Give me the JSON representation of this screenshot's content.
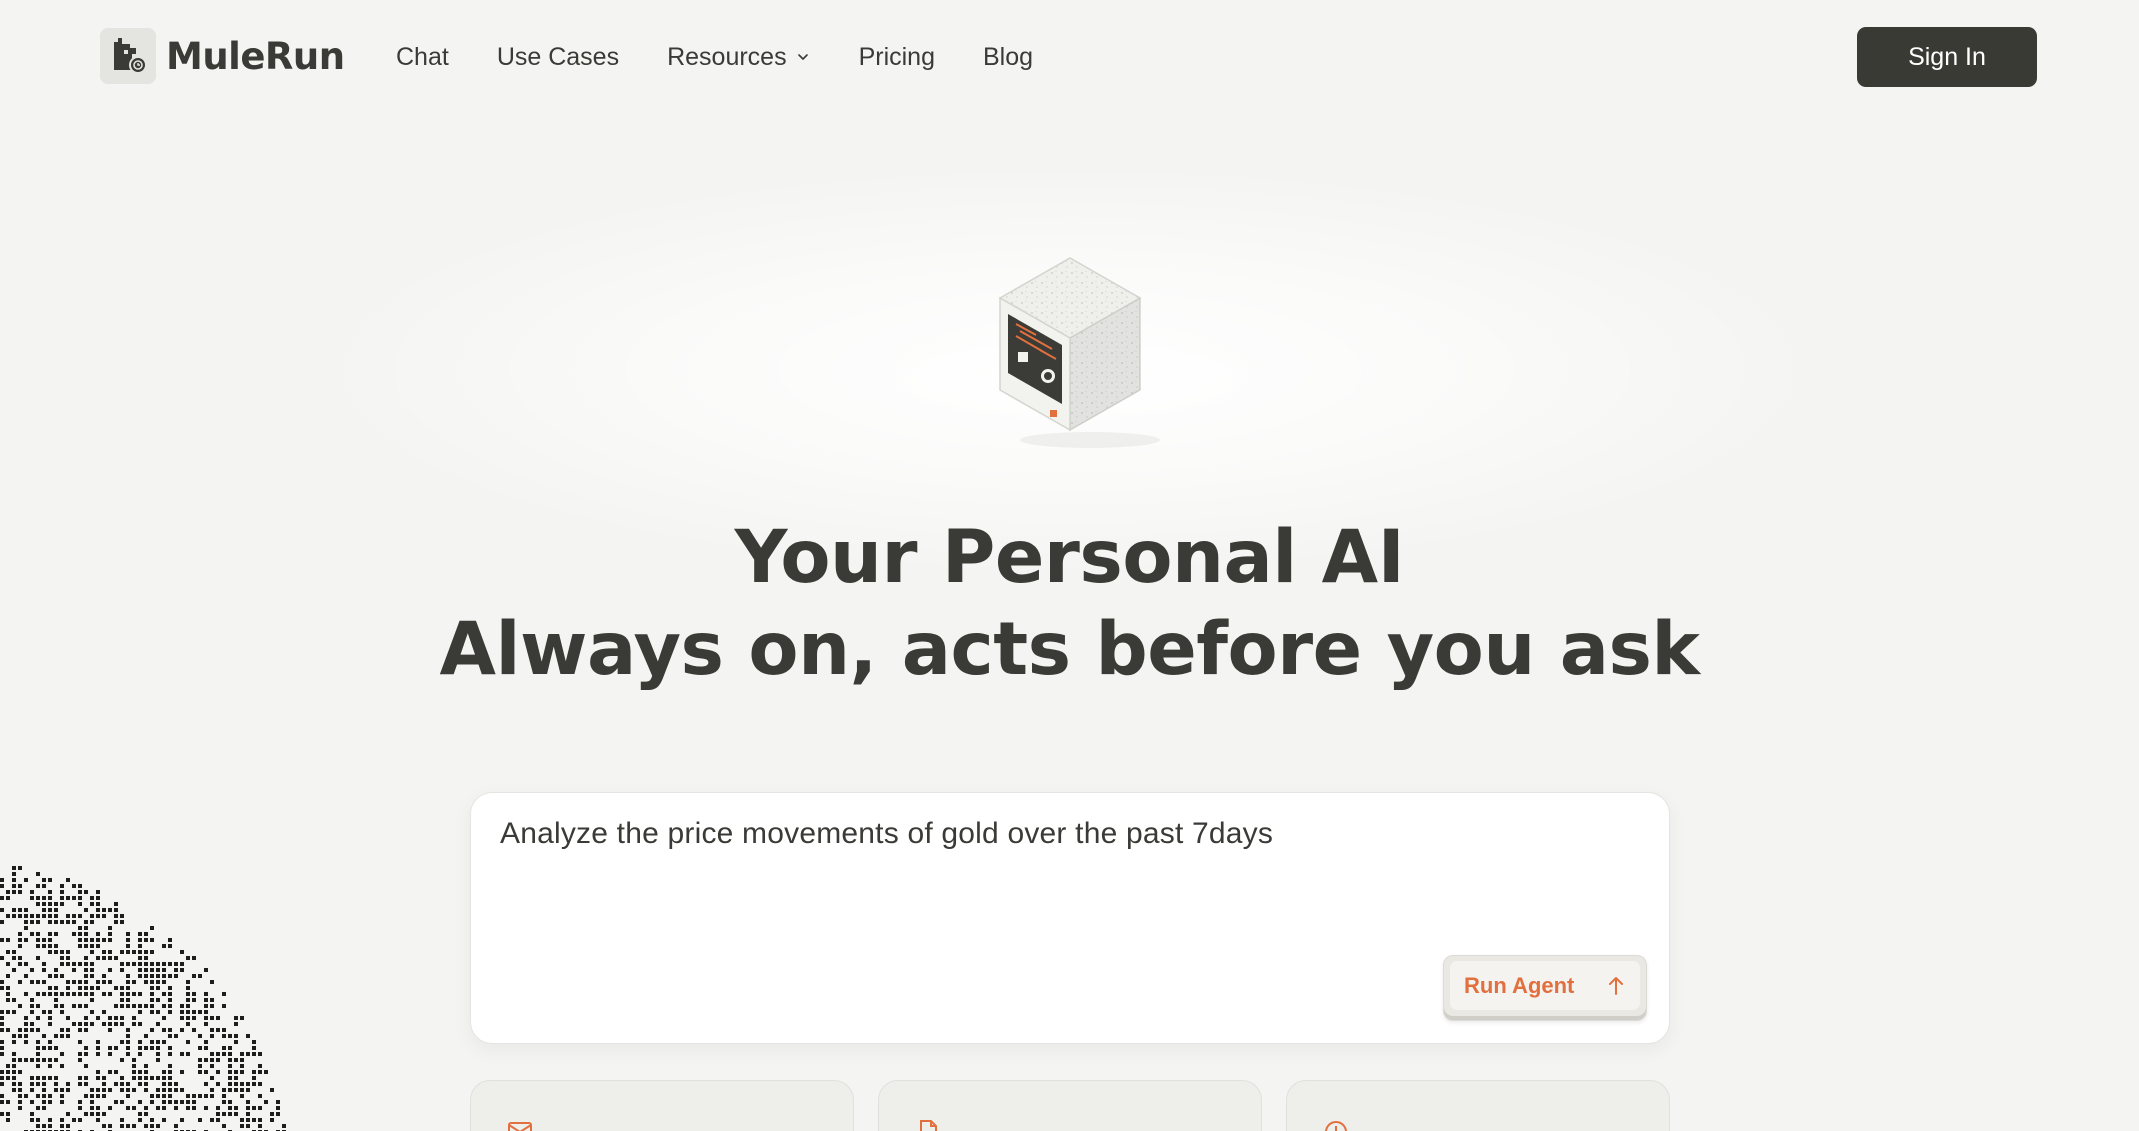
{
  "brand": {
    "name": "MuleRun",
    "logo_icon": "mule-logo-icon"
  },
  "nav": {
    "links": [
      {
        "label": "Chat"
      },
      {
        "label": "Use Cases"
      },
      {
        "label": "Resources",
        "has_dropdown": true
      },
      {
        "label": "Pricing"
      },
      {
        "label": "Blog"
      }
    ],
    "signin_label": "Sign In"
  },
  "hero": {
    "line1": "Your Personal AI",
    "line2": "Always on, acts before you ask",
    "illustration_icon": "computer-cube-icon"
  },
  "prompt": {
    "value": "Analyze the price movements of gold over the past 7days",
    "run_label": "Run Agent",
    "run_icon": "arrow-up-icon"
  },
  "cards": [
    {
      "icon": "mail-icon"
    },
    {
      "icon": "document-icon"
    },
    {
      "icon": "clock-icon"
    }
  ],
  "colors": {
    "background": "#f4f4f2",
    "text": "#3a3a36",
    "accent": "#e2703f",
    "button_dark": "#3a3a35"
  }
}
